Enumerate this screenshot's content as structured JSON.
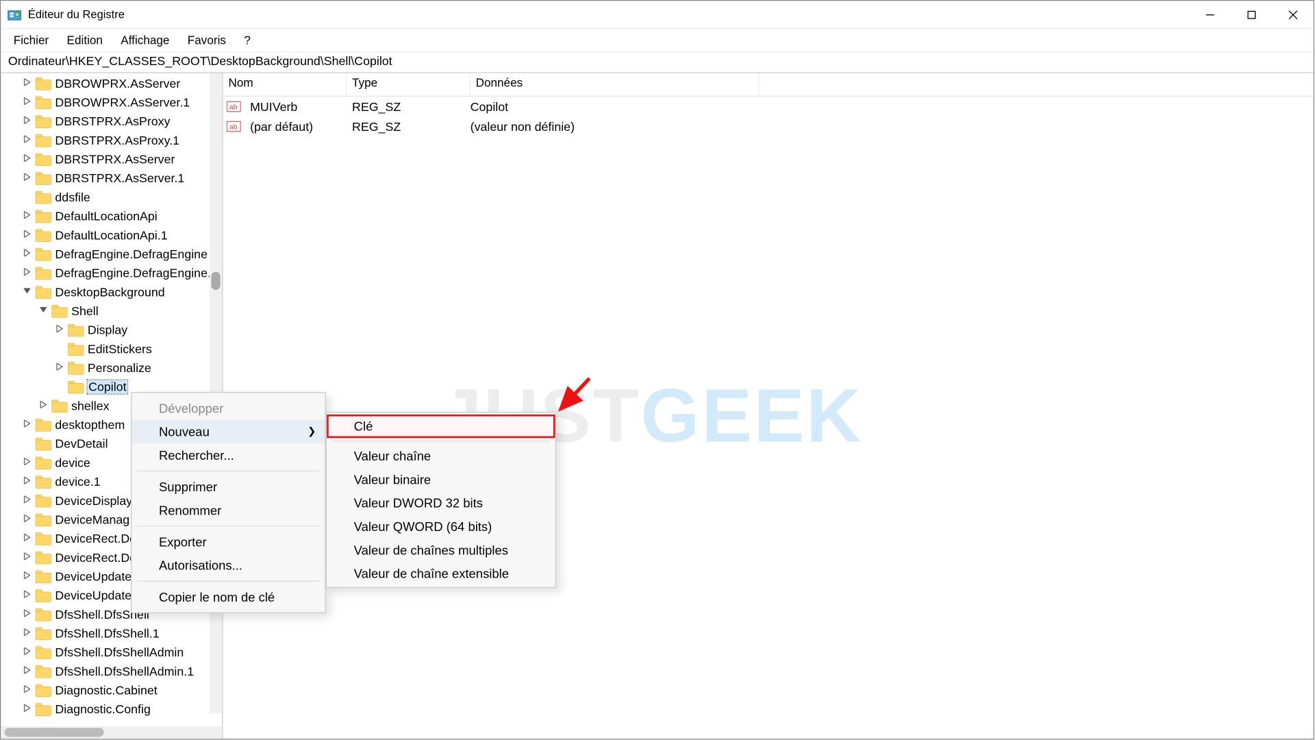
{
  "window": {
    "title": "Éditeur du Registre"
  },
  "menubar": [
    "Fichier",
    "Edition",
    "Affichage",
    "Favoris",
    "?"
  ],
  "pathbar": "Ordinateur\\HKEY_CLASSES_ROOT\\DesktopBackground\\Shell\\Copilot",
  "tree": {
    "items": [
      {
        "label": "DBROWPRX.AsServer",
        "indent": 1,
        "exp": ">"
      },
      {
        "label": "DBROWPRX.AsServer.1",
        "indent": 1,
        "exp": ">"
      },
      {
        "label": "DBRSTPRX.AsProxy",
        "indent": 1,
        "exp": ">"
      },
      {
        "label": "DBRSTPRX.AsProxy.1",
        "indent": 1,
        "exp": ">"
      },
      {
        "label": "DBRSTPRX.AsServer",
        "indent": 1,
        "exp": ">"
      },
      {
        "label": "DBRSTPRX.AsServer.1",
        "indent": 1,
        "exp": ">"
      },
      {
        "label": "ddsfile",
        "indent": 1,
        "exp": ""
      },
      {
        "label": "DefaultLocationApi",
        "indent": 1,
        "exp": ">"
      },
      {
        "label": "DefaultLocationApi.1",
        "indent": 1,
        "exp": ">"
      },
      {
        "label": "DefragEngine.DefragEngine",
        "indent": 1,
        "exp": ">"
      },
      {
        "label": "DefragEngine.DefragEngine.",
        "indent": 1,
        "exp": ">"
      },
      {
        "label": "DesktopBackground",
        "indent": 1,
        "exp": "v"
      },
      {
        "label": "Shell",
        "indent": 2,
        "exp": "v"
      },
      {
        "label": "Display",
        "indent": 3,
        "exp": ">"
      },
      {
        "label": "EditStickers",
        "indent": 3,
        "exp": ""
      },
      {
        "label": "Personalize",
        "indent": 3,
        "exp": ">"
      },
      {
        "label": "Copilot",
        "indent": 3,
        "exp": "",
        "selected": true
      },
      {
        "label": "shellex",
        "indent": 2,
        "exp": ">"
      },
      {
        "label": "desktopthem",
        "indent": 1,
        "exp": ">"
      },
      {
        "label": "DevDetail",
        "indent": 1,
        "exp": ""
      },
      {
        "label": "device",
        "indent": 1,
        "exp": ">"
      },
      {
        "label": "device.1",
        "indent": 1,
        "exp": ">"
      },
      {
        "label": "DeviceDisplay",
        "indent": 1,
        "exp": ">"
      },
      {
        "label": "DeviceManag",
        "indent": 1,
        "exp": ">"
      },
      {
        "label": "DeviceRect.De",
        "indent": 1,
        "exp": ">"
      },
      {
        "label": "DeviceRect.De",
        "indent": 1,
        "exp": ">"
      },
      {
        "label": "DeviceUpdate",
        "indent": 1,
        "exp": ">"
      },
      {
        "label": "DeviceUpdate",
        "indent": 1,
        "exp": ">"
      },
      {
        "label": "DfsShell.DfsShell",
        "indent": 1,
        "exp": ">"
      },
      {
        "label": "DfsShell.DfsShell.1",
        "indent": 1,
        "exp": ">"
      },
      {
        "label": "DfsShell.DfsShellAdmin",
        "indent": 1,
        "exp": ">"
      },
      {
        "label": "DfsShell.DfsShellAdmin.1",
        "indent": 1,
        "exp": ">"
      },
      {
        "label": "Diagnostic.Cabinet",
        "indent": 1,
        "exp": ">"
      },
      {
        "label": "Diagnostic.Config",
        "indent": 1,
        "exp": ">"
      }
    ]
  },
  "list": {
    "columns": {
      "name": "Nom",
      "type": "Type",
      "data": "Données"
    },
    "col_widths": {
      "name": 137,
      "type": 137,
      "data": 320
    },
    "rows": [
      {
        "name": "(par défaut)",
        "type": "REG_SZ",
        "data": "(valeur non définie)"
      },
      {
        "name": "MUIVerb",
        "type": "REG_SZ",
        "data": "Copilot"
      }
    ]
  },
  "context_menu": {
    "items": [
      {
        "label": "Développer",
        "disabled": true
      },
      {
        "label": "Nouveau",
        "hover": true,
        "submenu": true
      },
      {
        "label": "Rechercher..."
      },
      {
        "sep": true
      },
      {
        "label": "Supprimer"
      },
      {
        "label": "Renommer"
      },
      {
        "sep": true
      },
      {
        "label": "Exporter"
      },
      {
        "label": "Autorisations..."
      },
      {
        "sep": true
      },
      {
        "label": "Copier le nom de clé"
      }
    ],
    "submenu": [
      {
        "label": "Clé",
        "highlight": true
      },
      {
        "sep": true
      },
      {
        "label": "Valeur chaîne"
      },
      {
        "label": "Valeur binaire"
      },
      {
        "label": "Valeur DWORD 32 bits"
      },
      {
        "label": "Valeur QWORD (64 bits)"
      },
      {
        "label": "Valeur de chaînes multiples"
      },
      {
        "label": "Valeur de chaîne extensible"
      }
    ]
  },
  "watermark": {
    "a": "JUST",
    "b": "GEEK"
  }
}
